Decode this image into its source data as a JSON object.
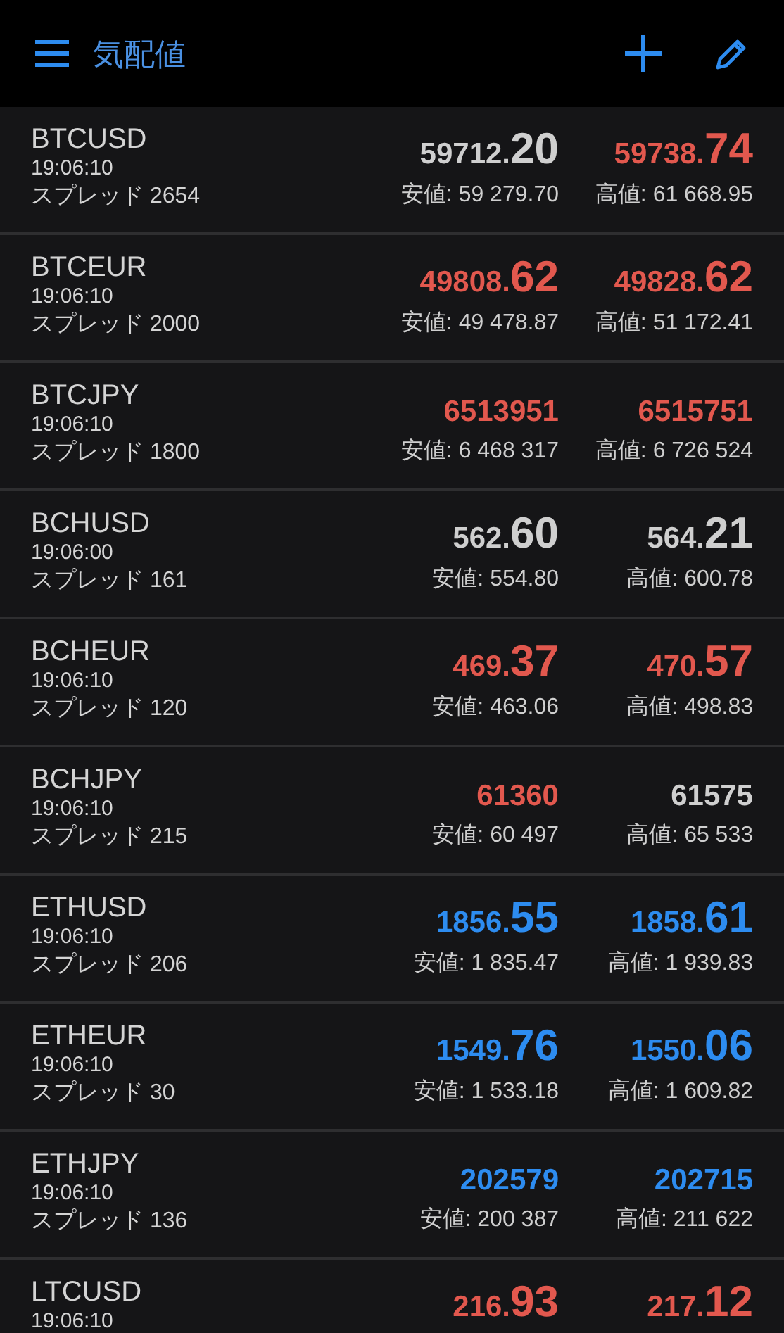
{
  "header": {
    "title": "気配値"
  },
  "quotes": [
    {
      "symbol": "BTCUSD",
      "time": "19:06:10",
      "spread": "スプレッド 2654",
      "bid": {
        "main": "59712.",
        "big": "20",
        "color": "#cfcfcf"
      },
      "ask": {
        "main": "59738.",
        "big": "74",
        "color": "#e2584e"
      },
      "low": "安値: 59 279.70",
      "high": "高値: 61 668.95"
    },
    {
      "symbol": "BTCEUR",
      "time": "19:06:10",
      "spread": "スプレッド 2000",
      "bid": {
        "main": "49808.",
        "big": "62",
        "color": "#e2584e"
      },
      "ask": {
        "main": "49828.",
        "big": "62",
        "color": "#e2584e"
      },
      "low": "安値: 49 478.87",
      "high": "高値: 51 172.41"
    },
    {
      "symbol": "BTCJPY",
      "time": "19:06:10",
      "spread": "スプレッド 1800",
      "bid": {
        "main": "6513951",
        "color": "#e2584e"
      },
      "ask": {
        "main": "6515751",
        "color": "#e2584e"
      },
      "low": "安値: 6 468 317",
      "high": "高値: 6 726 524"
    },
    {
      "symbol": "BCHUSD",
      "time": "19:06:00",
      "spread": "スプレッド 161",
      "bid": {
        "main": "562.",
        "big": "60",
        "color": "#cfcfcf"
      },
      "ask": {
        "main": "564.",
        "big": "21",
        "color": "#cfcfcf"
      },
      "low": "安値: 554.80",
      "high": "高値: 600.78"
    },
    {
      "symbol": "BCHEUR",
      "time": "19:06:10",
      "spread": "スプレッド 120",
      "bid": {
        "main": "469.",
        "big": "37",
        "color": "#e2584e"
      },
      "ask": {
        "main": "470.",
        "big": "57",
        "color": "#e2584e"
      },
      "low": "安値: 463.06",
      "high": "高値: 498.83"
    },
    {
      "symbol": "BCHJPY",
      "time": "19:06:10",
      "spread": "スプレッド 215",
      "bid": {
        "main": "61360",
        "color": "#e2584e"
      },
      "ask": {
        "main": "61575",
        "color": "#cfcfcf"
      },
      "low": "安値: 60 497",
      "high": "高値: 65 533"
    },
    {
      "symbol": "ETHUSD",
      "time": "19:06:10",
      "spread": "スプレッド 206",
      "bid": {
        "main": "1856.",
        "big": "55",
        "color": "#2d8cf0"
      },
      "ask": {
        "main": "1858.",
        "big": "61",
        "color": "#2d8cf0"
      },
      "low": "安値: 1 835.47",
      "high": "高値: 1 939.83"
    },
    {
      "symbol": "ETHEUR",
      "time": "19:06:10",
      "spread": "スプレッド 30",
      "bid": {
        "main": "1549.",
        "big": "76",
        "color": "#2d8cf0"
      },
      "ask": {
        "main": "1550.",
        "big": "06",
        "color": "#2d8cf0"
      },
      "low": "安値: 1 533.18",
      "high": "高値: 1 609.82"
    },
    {
      "symbol": "ETHJPY",
      "time": "19:06:10",
      "spread": "スプレッド 136",
      "bid": {
        "main": "202579",
        "color": "#2d8cf0"
      },
      "ask": {
        "main": "202715",
        "color": "#2d8cf0"
      },
      "low": "安値: 200 387",
      "high": "高値: 211 622"
    },
    {
      "symbol": "LTCUSD",
      "time": "19:06:10",
      "bid": {
        "main": "216.",
        "big": "93",
        "color": "#e2584e"
      },
      "ask": {
        "main": "217.",
        "big": "12",
        "color": "#e2584e"
      }
    }
  ]
}
